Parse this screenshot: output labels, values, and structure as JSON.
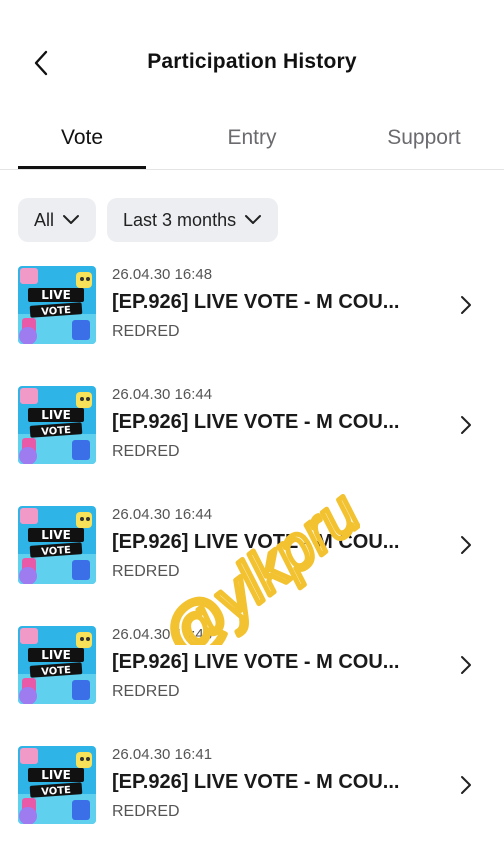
{
  "header": {
    "title": "Participation History",
    "back_icon": "chevron-left-icon"
  },
  "tabs": [
    {
      "label": "Vote",
      "active": true
    },
    {
      "label": "Entry",
      "active": false
    },
    {
      "label": "Support",
      "active": false
    }
  ],
  "filters": [
    {
      "label": "All",
      "icon": "chevron-down-icon"
    },
    {
      "label": "Last 3 months",
      "icon": "chevron-down-icon"
    }
  ],
  "items": [
    {
      "timestamp": "26.04.30 16:48",
      "title": "[EP.926] LIVE VOTE - M COU...",
      "subtitle": "REDRED",
      "thumbnail": "live-vote-thumbnail"
    },
    {
      "timestamp": "26.04.30 16:44",
      "title": "[EP.926] LIVE VOTE - M COU...",
      "subtitle": "REDRED",
      "thumbnail": "live-vote-thumbnail"
    },
    {
      "timestamp": "26.04.30 16:44",
      "title": "[EP.926] LIVE VOTE - M COU...",
      "subtitle": "REDRED",
      "thumbnail": "live-vote-thumbnail"
    },
    {
      "timestamp": "26.04.30 16:43",
      "title": "[EP.926] LIVE VOTE - M COU...",
      "subtitle": "REDRED",
      "thumbnail": "live-vote-thumbnail"
    },
    {
      "timestamp": "26.04.30 16:41",
      "title": "[EP.926] LIVE VOTE - M COU...",
      "subtitle": "REDRED",
      "thumbnail": "live-vote-thumbnail"
    }
  ],
  "thumbnail_text": {
    "line1": "LIVE",
    "line2": "VOTE"
  },
  "watermark": {
    "text": "@ylkpru",
    "color": "#f2c230"
  },
  "colors": {
    "chip_bg": "#eceef2",
    "tab_underline": "#111111",
    "thumb_bg": "#2fb4e8"
  }
}
